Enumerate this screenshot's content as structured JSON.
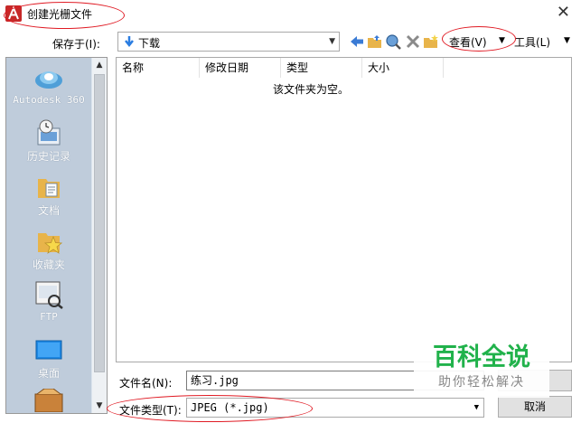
{
  "window": {
    "title": "创建光栅文件"
  },
  "save_in": {
    "label": "保存于(I):",
    "location": "下载"
  },
  "toolbar": {
    "view_label": "查看(V)",
    "tools_label": "工具(L)"
  },
  "places": [
    {
      "label": "Autodesk 360"
    },
    {
      "label": "历史记录"
    },
    {
      "label": "文档"
    },
    {
      "label": "收藏夹"
    },
    {
      "label": "FTP"
    },
    {
      "label": "桌面"
    }
  ],
  "columns": [
    "名称",
    "修改日期",
    "类型",
    "大小"
  ],
  "empty_message": "该文件夹为空。",
  "file_name": {
    "label": "文件名(N):",
    "value": "练习.jpg"
  },
  "file_type": {
    "label": "文件类型(T):",
    "value": "JPEG (*.jpg)"
  },
  "buttons": {
    "cancel": "取消"
  },
  "watermark": {
    "line1": "百科全说",
    "line2": "助你轻松解决"
  },
  "colors": {
    "annotation": "#e01b24",
    "accent_green": "#21b24b",
    "places_bg": "#bfccdb"
  }
}
